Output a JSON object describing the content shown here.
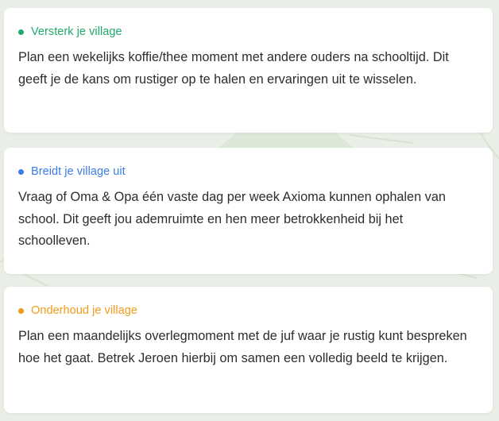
{
  "cards": [
    {
      "title": "Versterk je village",
      "color": "#1faa6c",
      "text": "Plan een wekelijks koffie/thee moment met andere ouders na schooltijd. Dit geeft je de kans om rustiger op te halen en ervaringen uit te wisselen."
    },
    {
      "title": "Breidt je village uit",
      "color": "#3b7de6",
      "text": "Vraag of Oma & Opa één vaste dag per week Axioma kunnen ophalen van school. Dit geeft jou ademruimte en hen meer betrokkenheid bij het schoolleven."
    },
    {
      "title": "Onderhoud je village",
      "color": "#f29a1a",
      "text": "Plan een maandelijks overlegmoment met de juf waar je rustig kunt bespreken hoe het gaat. Betrek Jeroen hierbij om samen een volledig beeld te krijgen."
    }
  ]
}
